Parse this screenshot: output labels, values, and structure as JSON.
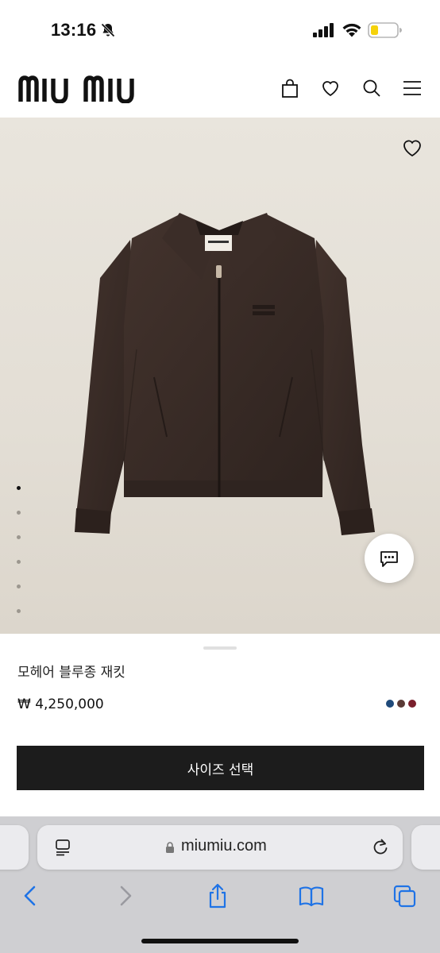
{
  "status_bar": {
    "time": "13:16",
    "icons": [
      "bell-slash-icon",
      "cellular-signal-icon",
      "wifi-icon",
      "battery-low-power-icon"
    ],
    "battery_color": "#f5d20b"
  },
  "header": {
    "logo_text": "miu miu",
    "icons": [
      "shopping-bag-icon",
      "heart-icon",
      "search-icon",
      "menu-icon"
    ]
  },
  "product_image": {
    "alt": "dark brown zip-up blouson jacket",
    "gallery_count": 6,
    "gallery_active_index": 0,
    "jacket_color": "#3a2c27"
  },
  "product": {
    "name": "모헤어 블루종 재킷",
    "price": "₩ 4,250,000",
    "color_swatches": [
      "#1f4a7a",
      "#5a3a36",
      "#7a1f2c"
    ],
    "size_button_label": "사이즈 선택"
  },
  "browser": {
    "url": "miumiu.com",
    "toolbar_icons": [
      "back-icon",
      "forward-icon",
      "share-icon",
      "bookmarks-icon",
      "tabs-icon"
    ],
    "accent_color": "#1f73e6"
  }
}
